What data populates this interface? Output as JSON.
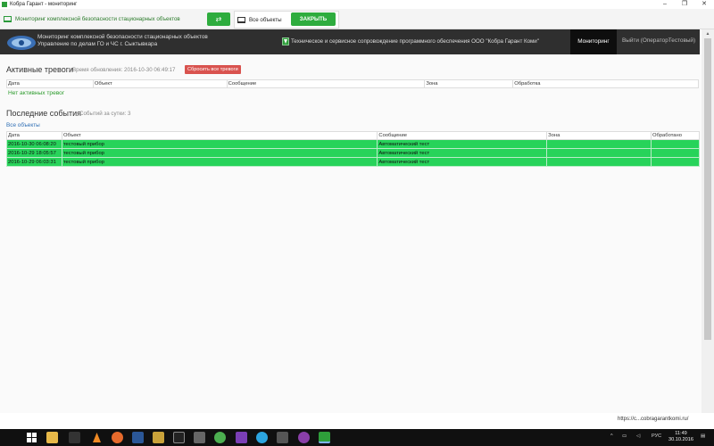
{
  "window": {
    "title": "Кобра Гарант - мониторинг",
    "minimize": "–",
    "maximize": "❐",
    "close": "✕"
  },
  "appbar": {
    "monitoring_label": "Мониторинг комплексной безопасности стационарных объектов",
    "swap_icon": "⇄",
    "all_objects": "Все объекты",
    "close_button": "ЗАКРЫТЬ"
  },
  "nav": {
    "org_line1": "Мониторинг комплексной безопасности стационарных объектов",
    "org_line2": "Управление по делам ГО и ЧС г. Сыктывкара",
    "support": "Техническое и сервисное сопровождение программного обеспечения ООО \"Кобра Гарант Коми\"",
    "monitoring_tab": "Мониторинг",
    "logout": "Выйти (ОператорТестовый)"
  },
  "alarms": {
    "title": "Активные тревоги",
    "updated": "Время обновления: 2016-10-30 06:49:17",
    "reset_button": "Сбросить все тревоги",
    "columns": [
      "Дата",
      "Объект",
      "Сообщение",
      "Зона",
      "Обработка"
    ],
    "empty_text": "Нет активных тревог"
  },
  "events": {
    "title": "Последние события",
    "count": "Событий за сутки: 3",
    "filter_link": "Все объекты",
    "columns": [
      "Дата",
      "Объект",
      "Сообщение",
      "Зона",
      "Обработано"
    ],
    "rows": [
      [
        "2016-10-30 06:08:20",
        "тестовый прибор",
        "Автоматический тест",
        "",
        ""
      ],
      [
        "2016-10-29 18:05:57",
        "тестовый прибор",
        "Автоматический тест",
        "",
        ""
      ],
      [
        "2016-10-29 06:03:31",
        "тестовый прибор",
        "Автоматический тест",
        "",
        ""
      ]
    ],
    "row_color": "#27d35a"
  },
  "status_url": "https://c...cobragarantkomi.ru/",
  "taskbar": {
    "icons": [
      "windows-start-icon",
      "search-icon",
      "task-view-icon",
      "file-explorer-icon",
      "vlc-icon",
      "firefox-icon",
      "word-icon",
      "archive-icon",
      "cmd-icon",
      "chrome-icon",
      "visual-studio-icon",
      "telegram-icon",
      "mail-icon",
      "app-icon",
      "kobra-garant-icon"
    ],
    "language": "РУС",
    "time": "11:49",
    "date": "30.10.2016"
  }
}
